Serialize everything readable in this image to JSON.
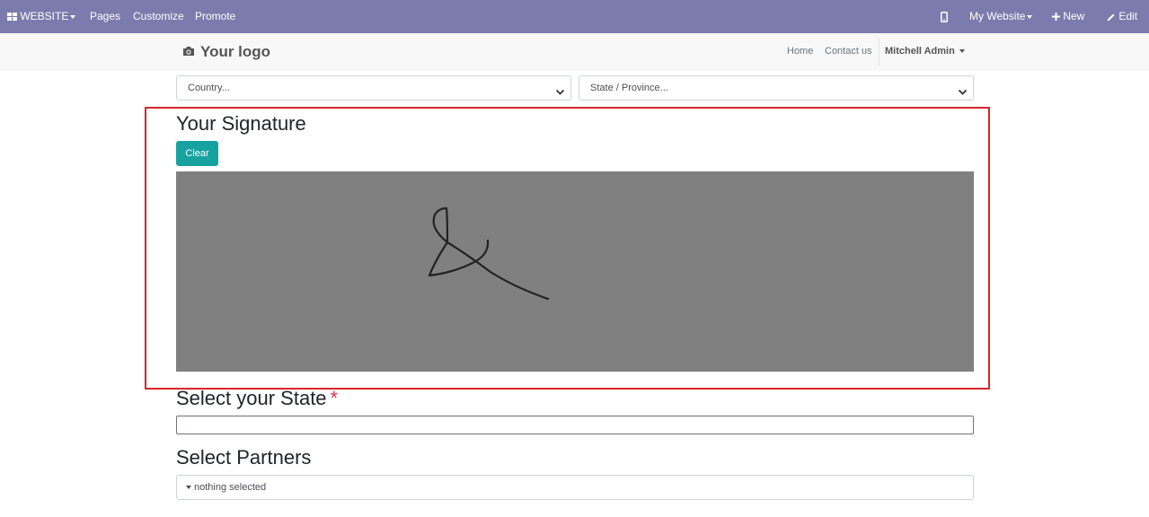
{
  "topbar": {
    "website_label": "WEBSITE",
    "pages_label": "Pages",
    "customize_label": "Customize",
    "promote_label": "Promote",
    "my_website_label": "My Website",
    "new_label": "New",
    "edit_label": "Edit",
    "icons": [
      "apps-grid-icon",
      "mobile-preview-icon",
      "plus-icon",
      "pencil-icon"
    ],
    "background_color": "#7c7bad"
  },
  "header": {
    "logo_text": "Your logo",
    "nav": {
      "home": "Home",
      "contact": "Contact us"
    },
    "user_name": "Mitchell Admin"
  },
  "form": {
    "country_select": "Country...",
    "state_province_select": "State / Province...",
    "signature": {
      "title": "Your Signature",
      "clear_label": "Clear",
      "pad_color": "#808080"
    },
    "select_state": {
      "title": "Select your State",
      "required_mark": "*",
      "value": ""
    },
    "select_partners": {
      "title": "Select Partners",
      "value": "nothing selected"
    },
    "accent_color": "#17a2a0",
    "highlight_color": "#d9262c"
  }
}
